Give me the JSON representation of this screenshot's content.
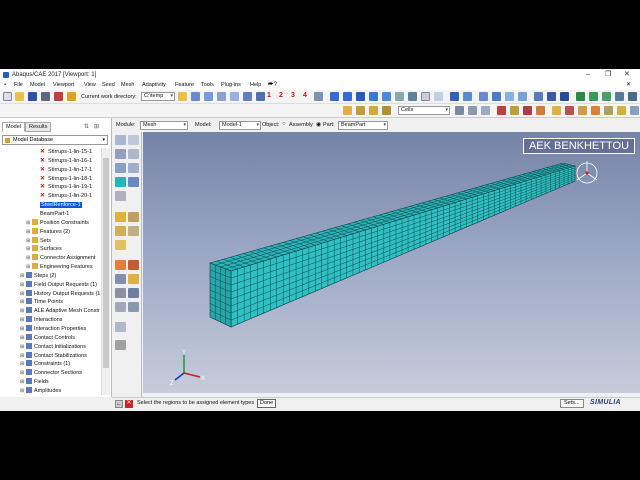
{
  "window": {
    "title": "Abaqus/CAE 2017 [Viewport: 1]",
    "controls": [
      "–",
      "❐",
      "✕"
    ]
  },
  "menu": [
    "File",
    "Model",
    "Viewport",
    "View",
    "Seed",
    "Mesh",
    "Adaptivity",
    "Feature",
    "Tools",
    "Plug-ins",
    "Help"
  ],
  "toolbar": {
    "work_dir_label": "Current work directory:",
    "work_dir_value": "C:\\temp",
    "numbers": [
      "1",
      "2",
      "3",
      "4"
    ],
    "cells_value": "Cells"
  },
  "context": {
    "module_label": "Module:",
    "module_value": "Mesh",
    "model_label": "Model:",
    "model_value": "Model-1",
    "object_label": "Object:",
    "assembly_label": "Assembly",
    "part_label": "Part:",
    "part_value": "BeamPart"
  },
  "tabs": [
    "Model",
    "Results"
  ],
  "model_db": "Model Database",
  "tree": [
    {
      "label": "Stirrups-1-lin-15-1",
      "type": "x"
    },
    {
      "label": "Stirrups-1-lin-16-1",
      "type": "x"
    },
    {
      "label": "Stirrups-1-lin-17-1",
      "type": "x"
    },
    {
      "label": "Stirrups-1-lin-18-1",
      "type": "x"
    },
    {
      "label": "Stirrups-1-lin-19-1",
      "type": "x"
    },
    {
      "label": "Stirrups-1-lin-20-1",
      "type": "x"
    },
    {
      "label": "SteelRenforce-1",
      "type": "selected"
    },
    {
      "label": "BeamPart-1",
      "type": "plain"
    },
    {
      "label": "Position Constraints",
      "type": "folder"
    },
    {
      "label": "Features (2)",
      "type": "folder"
    },
    {
      "label": "Sets",
      "type": "folder"
    },
    {
      "label": "Surfaces",
      "type": "folder"
    },
    {
      "label": "Connector Assignment",
      "type": "folder"
    },
    {
      "label": "Engineering Features",
      "type": "folder"
    },
    {
      "label": "Steps (2)",
      "type": "node"
    },
    {
      "label": "Field Output Requests (1)",
      "type": "node"
    },
    {
      "label": "History Output Requests (1)",
      "type": "node"
    },
    {
      "label": "Time Points",
      "type": "node"
    },
    {
      "label": "ALE Adaptive Mesh Constr",
      "type": "node"
    },
    {
      "label": "Interactions",
      "type": "node"
    },
    {
      "label": "Interaction Properties",
      "type": "node"
    },
    {
      "label": "Contact Controls",
      "type": "node"
    },
    {
      "label": "Contact Initializations",
      "type": "node"
    },
    {
      "label": "Contact Stabilizations",
      "type": "node"
    },
    {
      "label": "Constraints (1)",
      "type": "node"
    },
    {
      "label": "Connector Sections",
      "type": "node"
    },
    {
      "label": "Fields",
      "type": "node"
    },
    {
      "label": "Amplitudes",
      "type": "node"
    }
  ],
  "viewport": {
    "watermark": "AEK BENKHETTOU",
    "mesh_color": "#2ab3b8",
    "triad_labels": {
      "x": "X",
      "y": "Y",
      "z": "Z"
    }
  },
  "status": {
    "prompt": "Select the regions to be assigned element types",
    "done": "Done",
    "sets": "Sets...",
    "brand": "SIMULIA"
  }
}
